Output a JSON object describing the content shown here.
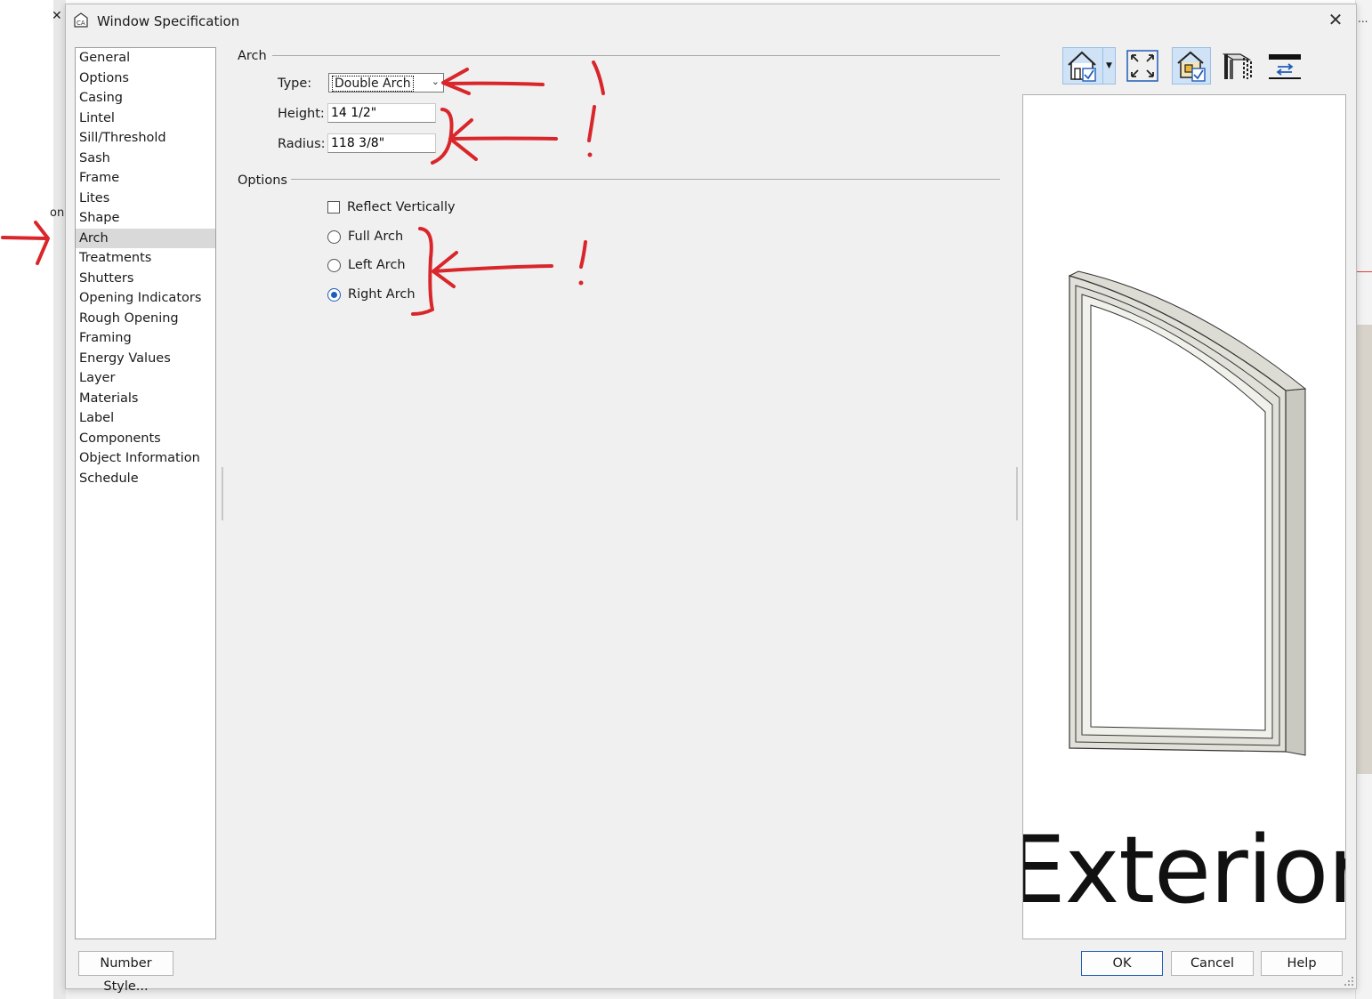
{
  "dialog": {
    "title": "Window Specification",
    "close_label": "✕"
  },
  "background": {
    "left_close": "✕",
    "left_fragment": "on",
    "right_ellipsis": "..."
  },
  "nav": {
    "items": [
      {
        "label": "General"
      },
      {
        "label": "Options"
      },
      {
        "label": "Casing"
      },
      {
        "label": "Lintel"
      },
      {
        "label": "Sill/Threshold"
      },
      {
        "label": "Sash"
      },
      {
        "label": "Frame"
      },
      {
        "label": "Lites"
      },
      {
        "label": "Shape"
      },
      {
        "label": "Arch"
      },
      {
        "label": "Treatments"
      },
      {
        "label": "Shutters"
      },
      {
        "label": "Opening Indicators"
      },
      {
        "label": "Rough Opening"
      },
      {
        "label": "Framing"
      },
      {
        "label": "Energy Values"
      },
      {
        "label": "Layer"
      },
      {
        "label": "Materials"
      },
      {
        "label": "Label"
      },
      {
        "label": "Components"
      },
      {
        "label": "Object Information"
      },
      {
        "label": "Schedule"
      }
    ],
    "selected": "Arch"
  },
  "arch": {
    "section_label": "Arch",
    "type_label": "Type:",
    "type_value": "Double Arch",
    "height_label": "Height:",
    "height_value": "14 1/2\"",
    "radius_label": "Radius:",
    "radius_value": "118 3/8\""
  },
  "options": {
    "section_label": "Options",
    "reflect_vertically": {
      "label": "Reflect Vertically",
      "checked": false
    },
    "radios": [
      {
        "label": "Full Arch",
        "checked": false
      },
      {
        "label": "Left Arch",
        "checked": false
      },
      {
        "label": "Right Arch",
        "checked": true
      }
    ]
  },
  "toolbar": {
    "buttons": [
      "view-3d-icon",
      "fill-window-icon",
      "show-materials-icon",
      "wall-view-icon",
      "swap-icon"
    ]
  },
  "preview": {
    "label_text": "Exterior"
  },
  "footer": {
    "number_style_label": "Number Style...",
    "ok_label": "OK",
    "cancel_label": "Cancel",
    "help_label": "Help"
  },
  "colors": {
    "dialog_bg": "#f0f0f0",
    "selection": "#d9d9d9",
    "accent": "#1f5db8",
    "annotation": "#d9262b"
  }
}
